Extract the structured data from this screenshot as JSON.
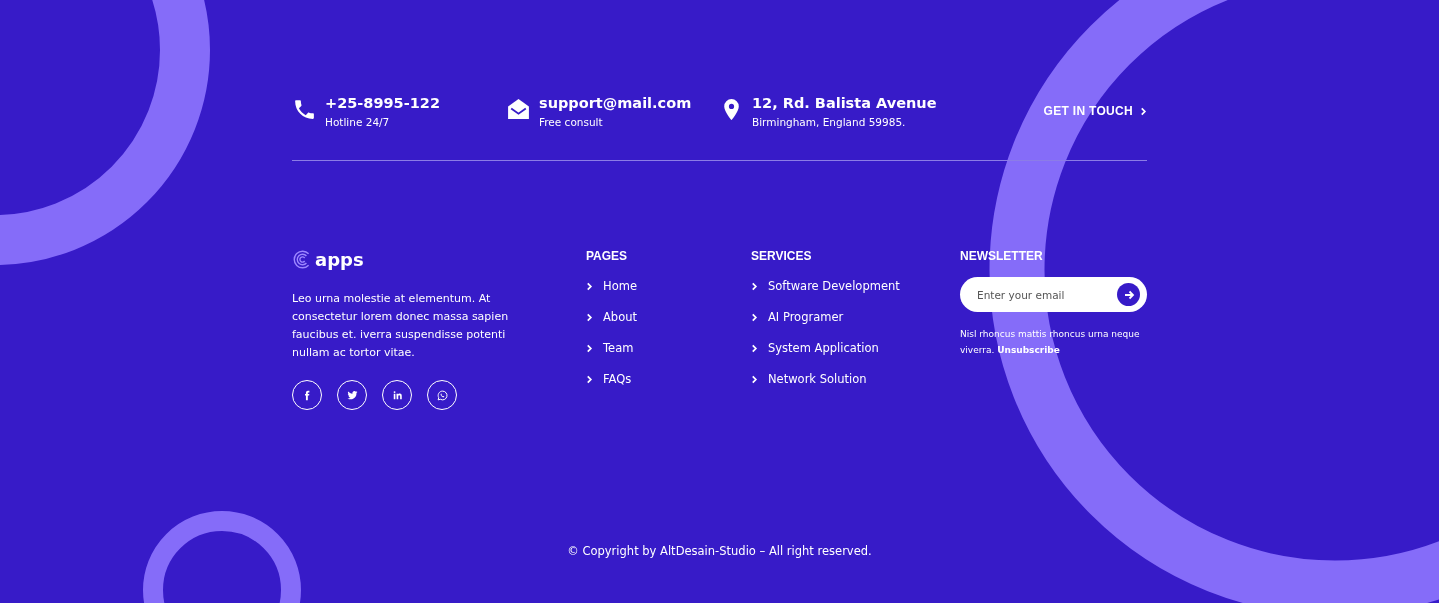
{
  "contacts": [
    {
      "kind": "phone",
      "title": "+25-8995-122",
      "subtitle": "Hotline 24/7"
    },
    {
      "kind": "mail",
      "title": "support@mail.com",
      "subtitle": "Free consult"
    },
    {
      "kind": "location",
      "title": "12, Rd. Balista Avenue",
      "subtitle": "Birmingham, England 59985."
    }
  ],
  "cta": {
    "label": "GET IN TOUCH"
  },
  "brand": {
    "name": "apps",
    "description": "Leo urna molestie at elementum. At consectetur lorem donec massa sapien faucibus et. iverra suspendisse potenti nullam ac tortor vitae."
  },
  "social": [
    {
      "kind": "facebook"
    },
    {
      "kind": "twitter"
    },
    {
      "kind": "linkedin"
    },
    {
      "kind": "whatsapp"
    }
  ],
  "pages": {
    "title": "PAGES",
    "items": [
      "Home",
      "About",
      "Team",
      "FAQs"
    ]
  },
  "services": {
    "title": "SERVICES",
    "items": [
      "Software Development",
      "AI Programer",
      "System Application",
      "Network Solution"
    ]
  },
  "newsletter": {
    "title": "NEWSLETTER",
    "placeholder": "Enter your email",
    "note": "Nisl rhoncus mattis rhoncus urna neque viverra.",
    "link": "Unsubscribe"
  },
  "copyright": "© Copyright by AltDesain-Studio – All right reserved."
}
